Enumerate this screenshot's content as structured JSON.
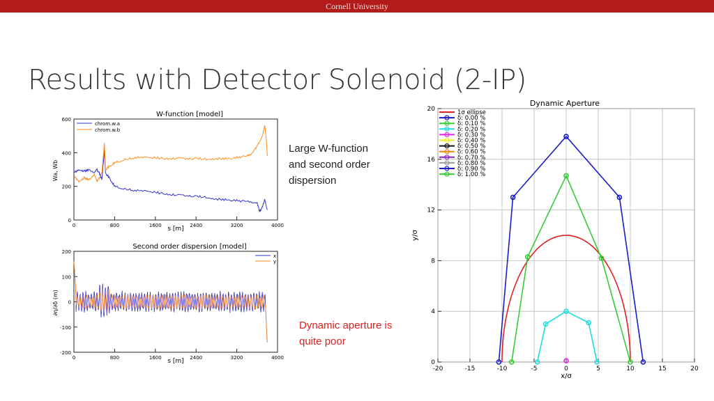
{
  "header": {
    "institution": "Cornell University"
  },
  "slide": {
    "title": "Results with Detector Solenoid (2-IP)",
    "note1": [
      "Large W-function",
      "and second order",
      "dispersion"
    ],
    "note2": [
      "Dynamic aperture is",
      "quite poor"
    ]
  },
  "chart_data": [
    {
      "type": "line",
      "title": "W-function [model]",
      "xlabel": "s [m]",
      "ylabel": "Wa, Wb",
      "xlim": [
        0,
        4000
      ],
      "ylim": [
        0,
        600
      ],
      "xticks": [
        0,
        800,
        1600,
        2400,
        3200,
        4000
      ],
      "yticks": [
        0,
        200,
        400,
        600
      ],
      "legend_position": "top-left",
      "series": [
        {
          "name": "chrom.w.a",
          "color": "#3333cc",
          "x": [
            0,
            100,
            200,
            300,
            400,
            450,
            500,
            550,
            600,
            620,
            700,
            800,
            1000,
            1200,
            1400,
            1600,
            1800,
            2000,
            2200,
            2400,
            2600,
            2800,
            3000,
            3200,
            3400,
            3600,
            3650,
            3700,
            3750,
            3800
          ],
          "y": [
            280,
            300,
            290,
            300,
            280,
            300,
            280,
            240,
            420,
            280,
            250,
            200,
            185,
            175,
            175,
            165,
            155,
            150,
            145,
            140,
            135,
            125,
            120,
            115,
            110,
            105,
            50,
            80,
            120,
            60
          ]
        },
        {
          "name": "chrom.w.b",
          "color": "#ff8c1a",
          "x": [
            0,
            100,
            200,
            300,
            400,
            450,
            500,
            550,
            600,
            620,
            700,
            800,
            1000,
            1200,
            1400,
            1600,
            1800,
            2000,
            2200,
            2400,
            2600,
            2800,
            3000,
            3200,
            3400,
            3500,
            3600,
            3700,
            3750,
            3780,
            3800
          ],
          "y": [
            260,
            230,
            250,
            240,
            270,
            230,
            250,
            280,
            460,
            300,
            320,
            340,
            360,
            370,
            375,
            370,
            365,
            368,
            365,
            365,
            362,
            365,
            365,
            370,
            380,
            400,
            440,
            500,
            560,
            480,
            380
          ]
        }
      ]
    },
    {
      "type": "line",
      "title": "Second order dispersion [model]",
      "xlabel": "s [m]",
      "ylabel": "∂η/∂δ (m)",
      "xlim": [
        0,
        4000
      ],
      "ylim": [
        -200,
        200
      ],
      "xticks": [
        0,
        800,
        1600,
        2400,
        3200,
        4000
      ],
      "yticks": [
        -200,
        -100,
        0,
        100,
        200
      ],
      "legend_position": "top-right",
      "series": [
        {
          "name": "x",
          "color": "#3333cc"
        },
        {
          "name": "y",
          "color": "#ff8c1a"
        }
      ]
    },
    {
      "type": "line",
      "title": "Dynamic Aperture",
      "xlabel": "x/σ",
      "ylabel": "y/σ",
      "xlim": [
        -20,
        20
      ],
      "ylim": [
        0,
        20
      ],
      "xticks": [
        -20,
        -15,
        -10,
        -5,
        0,
        5,
        10,
        15,
        20
      ],
      "yticks": [
        0,
        4,
        8,
        12,
        16,
        20
      ],
      "grid": true,
      "legend_position": "top-left",
      "legend": [
        {
          "label": "1σ ellipse",
          "color": "#e02020"
        },
        {
          "label": "δ: 0.00 %",
          "color": "#1a1acc"
        },
        {
          "label": "δ: 0.10 %",
          "color": "#33cc33"
        },
        {
          "label": "δ: 0.20 %",
          "color": "#22dddd"
        },
        {
          "label": "δ: 0.30 %",
          "color": "#ee22ee"
        },
        {
          "label": "δ: 0.40 %",
          "color": "#eeee22"
        },
        {
          "label": "δ: 0.50 %",
          "color": "#111111"
        },
        {
          "label": "δ: 0.60 %",
          "color": "#ee8811"
        },
        {
          "label": "δ: 0.70 %",
          "color": "#8822cc"
        },
        {
          "label": "δ: 0.80 %",
          "color": "#999999"
        },
        {
          "label": "δ: 0.90 %",
          "color": "#1a1acc"
        },
        {
          "label": "δ: 1.00 %",
          "color": "#33cc33"
        }
      ],
      "ellipse": {
        "rx": 10,
        "ry": 10,
        "color": "#e02020"
      },
      "series": [
        {
          "name": "δ: 0.00 %",
          "color": "#1a1acc",
          "x": [
            -10.5,
            -8.3,
            0,
            8.3,
            12
          ],
          "y": [
            0,
            13,
            17.8,
            13,
            0
          ]
        },
        {
          "name": "δ: 0.10 %",
          "color": "#33cc33",
          "x": [
            -8.5,
            -6,
            0,
            5.5,
            10
          ],
          "y": [
            0,
            8.3,
            14.7,
            8.2,
            0
          ]
        },
        {
          "name": "δ: 0.20 %",
          "color": "#22dddd",
          "x": [
            -4.5,
            -3.2,
            0,
            3.5,
            4.8
          ],
          "y": [
            0,
            3,
            4,
            3.1,
            0
          ]
        },
        {
          "name": "δ: 0.30 %",
          "color": "#ee22ee",
          "x": [
            0
          ],
          "y": [
            0.1
          ]
        }
      ]
    }
  ]
}
